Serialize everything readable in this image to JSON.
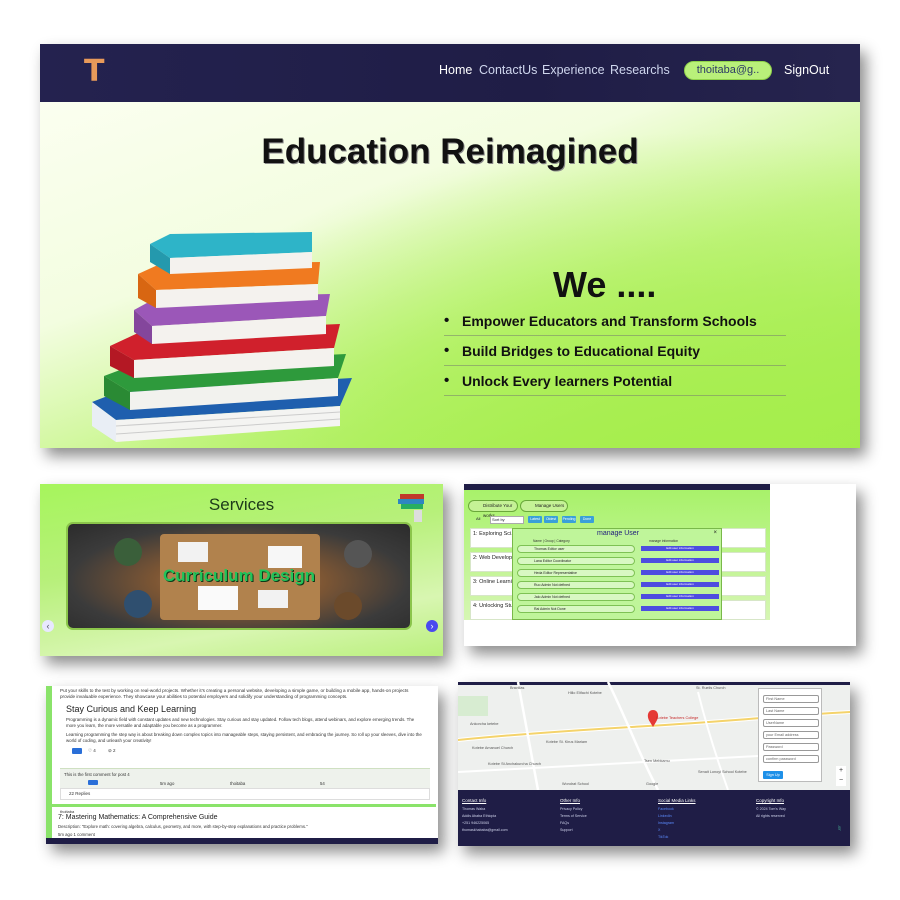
{
  "hero": {
    "logo": "T",
    "nav": [
      "Home",
      "ContactUs",
      "Experience",
      "Researchs"
    ],
    "user_email": "thoitaba@g..",
    "signout": "SignOut",
    "title": "Education Reimagined",
    "we": "We ....",
    "bullets": [
      "Empower Educators and Transform Schools",
      "Build Bridges to Educational Equity",
      "Unlock Every learners Potential"
    ],
    "accent_color": "#e89a5a",
    "nav_bg": "#24224f",
    "pill_color": "#b9f07a"
  },
  "services": {
    "title": "Services",
    "slide_label": "Curriculum Design",
    "prev_icon": "chevron-left-icon",
    "next_icon": "chevron-right-icon"
  },
  "manage": {
    "tabs": [
      "Distribute Your works",
      "Manage Users"
    ],
    "filter_all": "All",
    "sort_by": "Sort by",
    "filter_buttons": [
      "Latest",
      "Oldest",
      "Pending",
      "Done"
    ],
    "posts": [
      "1: Exploring Sci...",
      "2: Web Develop...",
      "3: Online Learni...",
      "4: Unlocking Stu..."
    ],
    "modal_title": "manage User",
    "modal_close": "×",
    "modal_headers": [
      "Name | Group | Category",
      "manage information"
    ],
    "users": [
      {
        "info": "Thomas   Editor   user",
        "action": "Edit user information"
      },
      {
        "info": "Lana   Editor   Coordinator",
        "action": "Edit user information"
      },
      {
        "info": "Heda   Editor   Representative",
        "action": "Edit user information"
      },
      {
        "info": "Ruo   Admin   Not defined",
        "action": "Edit user information"
      },
      {
        "info": "Jalo   Admin   Not defined",
        "action": "Edit user information"
      },
      {
        "info": "Rai   Admin   Not Done",
        "action": "Edit user information"
      }
    ]
  },
  "article": {
    "intro": "Put your skills to the test by working on real-world projects. Whether it's creating a personal website, developing a simple game, or building a mobile app, hands-on projects provide invaluable experience. They showcase your abilities to potential employers and solidify your understanding of programming concepts.",
    "heading": "Stay Curious and Keep Learning",
    "para1": "Programming is a dynamic field with constant updates and new technologies. Stay curious and stay updated. Follow tech blogs, attend webinars, and explore emerging trends. The more you learn, the more versatile and adaptable you become as a programmer.",
    "para2": "Learning programming the step way is about breaking down complex topics into manageable steps, staying persistent, and embracing the journey. So roll up your sleeves, dive into the world of coding, and unleash your creativity!",
    "likes": "4",
    "dislikes": "2",
    "comment": "This is the first comment for post 4",
    "comment_time": "5m ago",
    "comment_user": "thoitaba",
    "comment_count": "54",
    "replies": "22 Replies",
    "author": "thoitaba",
    "post7_title": "7: Mastering Mathematics: A Comprehensive Guide",
    "post7_desc": "Description: \"Explore math: covering algebra, calculus, geometry, and more, with step-by-step explanations and practice problems.\"",
    "post7_meta": "5m ago    1 comment"
  },
  "map": {
    "labels": [
      "Bravillas",
      "Hillo Elifachi Kotebe",
      "Ankorcha ketebe",
      "Kotebe Amanuel Church",
      "Kotebe St. Kirus Mariam",
      "Kotebe Teachers College",
      "Tsen Mebkamu",
      "Kotebe St Anchakurcha Church",
      "Senait Lonoyi School Kotebe",
      "St. Rueils Church",
      "Wondrat School",
      "Google"
    ],
    "signup_fields": [
      "First Name",
      "Last Name",
      "UserName",
      "your Email address",
      "Password",
      "confirm password"
    ],
    "signup_button": "Sign Up"
  },
  "footer": {
    "cols": [
      {
        "head": "Contact Info",
        "items": [
          "Thomas Waba",
          "Addis Ababa Ethiopia",
          "+251 946225065",
          "thomaskhababa@gmail.com"
        ]
      },
      {
        "head": "Other Info",
        "items": [
          "Privacy Policy",
          "Terms of Service",
          "FAQs",
          "Support"
        ]
      },
      {
        "head": "Social Media Links",
        "items": [
          "Facebook",
          "LinkedIn",
          "Instagram",
          "X",
          "TikTok"
        ]
      },
      {
        "head": "Copyright Info",
        "items": [
          "© 2024 Tom's Way",
          "All rights reserved"
        ]
      }
    ]
  }
}
